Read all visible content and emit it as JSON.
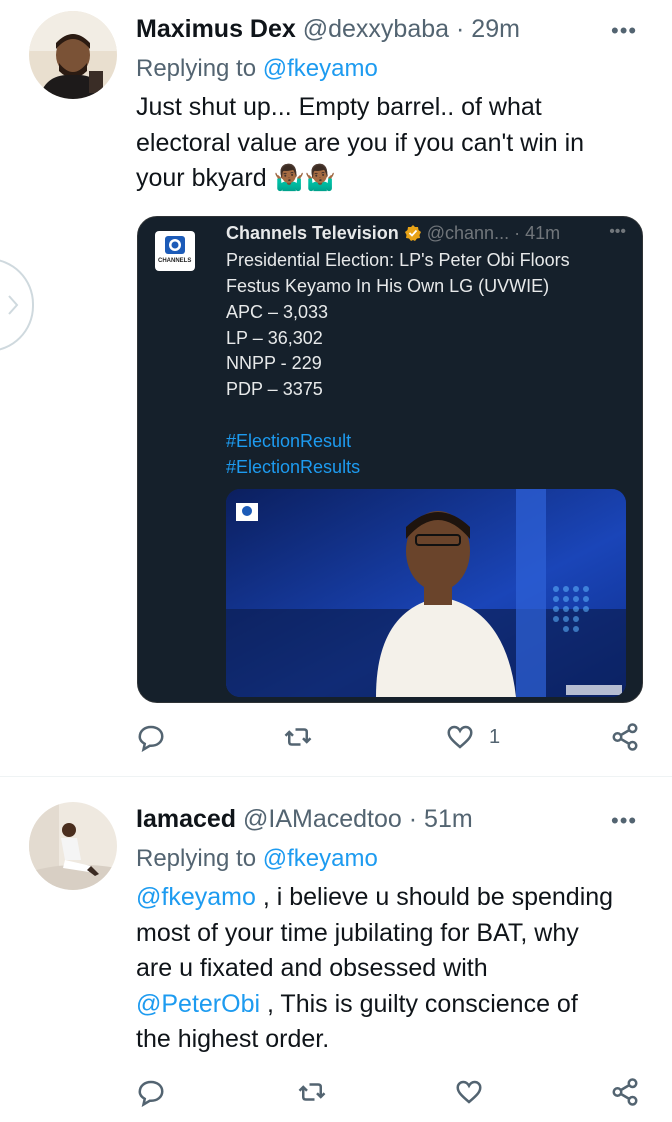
{
  "tweets": [
    {
      "name": "Maximus Dex",
      "handle": "@dexxybaba",
      "separator": "·",
      "time": "29m",
      "more": "•••",
      "replying_prefix": "Replying to",
      "replying_handle": "@fkeyamo",
      "text_lines": [
        "Just shut up... Empty barrel.. of what",
        "electoral value are you if you can't win in",
        "your bkyard"
      ],
      "emoji": "🤷🏾‍♂️🤷🏾‍♂️",
      "quote": {
        "name": "Channels Television",
        "handle": "@chann...",
        "separator": "·",
        "time": "41m",
        "more": "•••",
        "lines": [
          "Presidential Election: LP's Peter Obi Floors",
          "Festus Keyamo In His Own LG (UVWIE)",
          "APC – 3,033",
          "LP – 36,302",
          "NNPP -  229",
          "PDP – 3375"
        ],
        "hashtags": [
          "#ElectionResult",
          "#ElectionResults"
        ],
        "logo_text": "CHANNELS"
      },
      "actions": {
        "reply": "reply-icon",
        "retweet": "retweet-icon",
        "like": "heart-icon",
        "like_count": "1",
        "share": "share-icon"
      }
    },
    {
      "name": "Iamaced",
      "handle": "@IAMacedtoo",
      "separator": "·",
      "time": "51m",
      "more": "•••",
      "replying_prefix": "Replying to",
      "replying_handle": "@fkeyamo",
      "mention1": "@fkeyamo",
      "line1_rest": " , i believe u should be spending",
      "line2": "most of your time jubilating for BAT, why",
      "line3": "are u fixated and obsessed with",
      "mention2": "@PeterObi",
      "line4_rest": " , This is guilty conscience of",
      "line5": "the highest order.",
      "actions": {
        "reply": "reply-icon",
        "retweet": "retweet-icon",
        "like": "heart-icon",
        "share": "share-icon"
      }
    }
  ],
  "colors": {
    "accent": "#1d9bf0",
    "secondary": "#536471",
    "card_bg": "#15202b"
  }
}
